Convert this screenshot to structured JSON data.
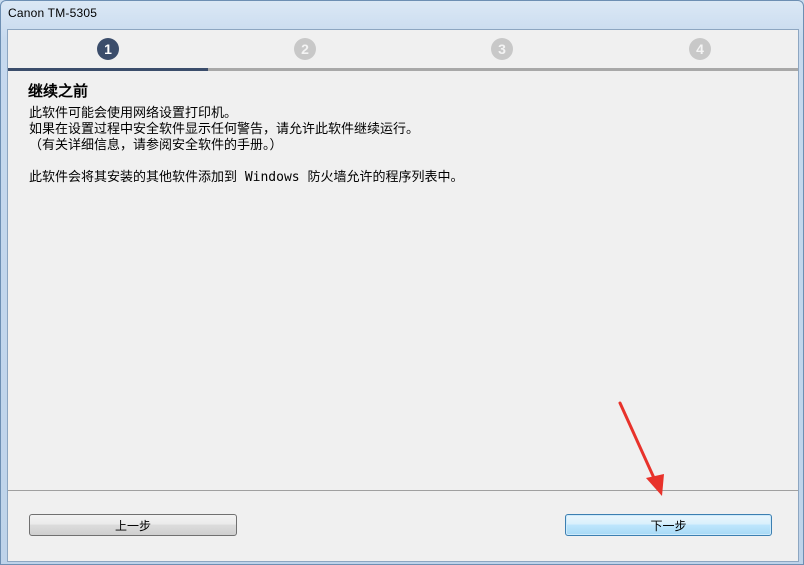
{
  "window": {
    "title": "Canon TM-5305"
  },
  "steps": [
    {
      "number": "1",
      "state": "active"
    },
    {
      "number": "2",
      "state": "inactive"
    },
    {
      "number": "3",
      "state": "inactive"
    },
    {
      "number": "4",
      "state": "inactive"
    }
  ],
  "content": {
    "heading": "继续之前",
    "lines": [
      "此软件可能会使用网络设置打印机。",
      "如果在设置过程中安全软件显示任何警告，请允许此软件继续运行。",
      "（有关详细信息，请参阅安全软件的手册。）",
      "",
      "此软件会将其安装的其他软件添加到 Windows 防火墙允许的程序列表中。"
    ]
  },
  "buttons": {
    "back_label": "上一步",
    "next_label": "下一步"
  },
  "colors": {
    "active_step": "#3b4d6b",
    "inactive_step": "#c8c8c8",
    "annotation_arrow": "#e8322b"
  },
  "icons": {
    "annotation": "red-arrow-icon"
  }
}
